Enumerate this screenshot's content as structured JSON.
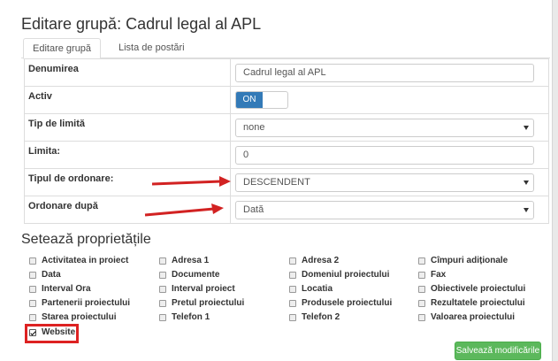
{
  "title": "Editare grupă: Cadrul legal al APL",
  "tabs": [
    {
      "label": "Editare grupă"
    },
    {
      "label": "Lista de postări"
    }
  ],
  "form": {
    "rows": [
      {
        "label": "Denumirea",
        "value": "Cadrul legal al APL"
      },
      {
        "label": "Activ",
        "value": "ON"
      },
      {
        "label": "Tip de limită",
        "value": "none"
      },
      {
        "label": "Limita:",
        "value": "0"
      },
      {
        "label": "Tipul de ordonare:",
        "value": "DESCENDENT"
      },
      {
        "label": "Ordonare după",
        "value": "Dată"
      }
    ]
  },
  "properties": {
    "title": "Setează proprietățile",
    "items": [
      {
        "label": "Activitatea in proiect",
        "checked": false
      },
      {
        "label": "Adresa 1",
        "checked": false
      },
      {
        "label": "Adresa 2",
        "checked": false
      },
      {
        "label": "Cîmpuri adiționale",
        "checked": false
      },
      {
        "label": "Data",
        "checked": false
      },
      {
        "label": "Documente",
        "checked": false
      },
      {
        "label": "Domeniul proiectului",
        "checked": false
      },
      {
        "label": "Fax",
        "checked": false
      },
      {
        "label": "Interval Ora",
        "checked": false
      },
      {
        "label": "Interval proiect",
        "checked": false
      },
      {
        "label": "Locatia",
        "checked": false
      },
      {
        "label": "Obiectivele proiectului",
        "checked": false
      },
      {
        "label": "Partenerii proiectului",
        "checked": false
      },
      {
        "label": "Pretul proiectului",
        "checked": false
      },
      {
        "label": "Produsele proiectului",
        "checked": false
      },
      {
        "label": "Rezultatele proiectului",
        "checked": false
      },
      {
        "label": "Starea proiectului",
        "checked": false
      },
      {
        "label": "Telefon 1",
        "checked": false
      },
      {
        "label": "Telefon 2",
        "checked": false
      },
      {
        "label": "Valoarea proiectului",
        "checked": false
      },
      {
        "label": "Website",
        "checked": true
      }
    ]
  },
  "save_button": "Salvează modificările",
  "colors": {
    "primary": "#337ab7",
    "success": "#5cb85c",
    "annotation": "#d22222"
  }
}
